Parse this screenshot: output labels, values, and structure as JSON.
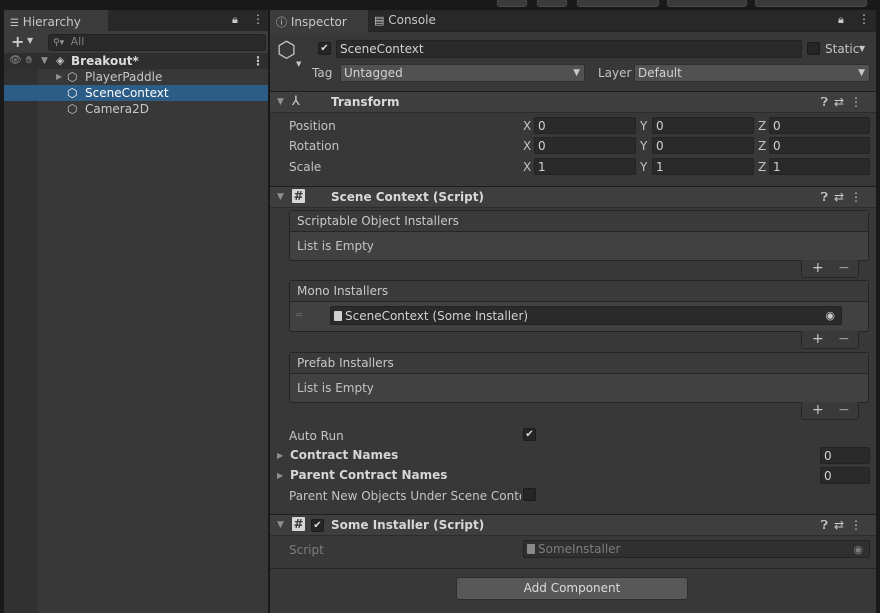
{
  "top": {},
  "hierarchy": {
    "tab_label": "Hierarchy",
    "search_placeholder": "All",
    "items": [
      {
        "label": "Breakout*"
      },
      {
        "label": "PlayerPaddle"
      },
      {
        "label": "SceneContext"
      },
      {
        "label": "Camera2D"
      }
    ]
  },
  "inspector": {
    "tabs": [
      {
        "label": "Inspector"
      },
      {
        "label": "Console"
      }
    ],
    "object_name": "SceneContext",
    "static_label": "Static",
    "tag_label": "Tag",
    "tag_value": "Untagged",
    "layer_label": "Layer",
    "layer_value": "Default",
    "transform": {
      "title": "Transform",
      "rows": [
        {
          "label": "Position",
          "x": "0",
          "y": "0",
          "z": "0"
        },
        {
          "label": "Rotation",
          "x": "0",
          "y": "0",
          "z": "0"
        },
        {
          "label": "Scale",
          "x": "1",
          "y": "1",
          "z": "1"
        }
      ],
      "axis": {
        "x": "X",
        "y": "Y",
        "z": "Z"
      }
    },
    "scene_context": {
      "title": "Scene Context (Script)",
      "so_installers": {
        "title": "Scriptable Object Installers",
        "empty": "List is Empty"
      },
      "mono_installers": {
        "title": "Mono Installers",
        "item": "SceneContext (Some Installer)"
      },
      "prefab_installers": {
        "title": "Prefab Installers",
        "empty": "List is Empty"
      },
      "auto_run_label": "Auto Run",
      "contract_names_label": "Contract Names",
      "contract_names_value": "0",
      "parent_contract_names_label": "Parent Contract Names",
      "parent_contract_names_value": "0",
      "parent_new_objects_label": "Parent New Objects Under Scene Conte:"
    },
    "some_installer": {
      "title": "Some Installer (Script)",
      "script_label": "Script",
      "script_value": "SomeInstaller"
    },
    "add_component_label": "Add Component"
  },
  "plus_minus": {
    "plus": "+",
    "minus": "−"
  },
  "colors": {
    "selection": "#2c5d87",
    "panel": "#383838",
    "field": "#2a2a2a"
  }
}
